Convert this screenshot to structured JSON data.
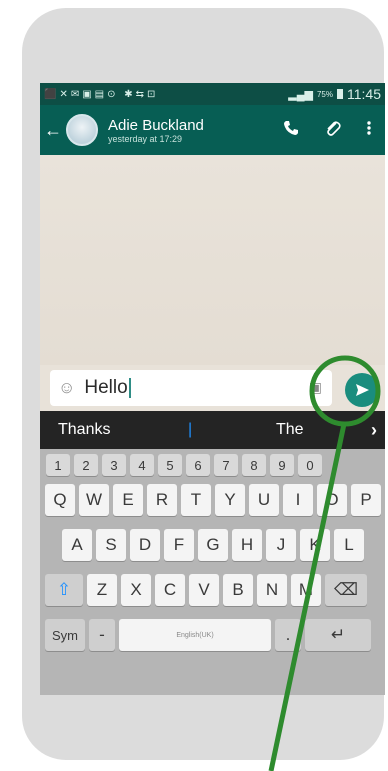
{
  "status": {
    "left_icons": "⬛✕✉▣▤⊙ ✱⇆⊡",
    "signal": "▂▄▆",
    "battery": "75%",
    "time": "11:45"
  },
  "header": {
    "back": "←",
    "name": "Adie Buckland",
    "last_seen": "yesterday at 17:29"
  },
  "composer": {
    "text": "Hello",
    "emoji": "☺",
    "camera": "▣"
  },
  "suggestions": {
    "left": "Thanks",
    "middle": "|",
    "right": "The",
    "arrow": "›"
  },
  "keyboard": {
    "numbers": [
      "1",
      "2",
      "3",
      "4",
      "5",
      "6",
      "7",
      "8",
      "9",
      "0"
    ],
    "row1": [
      "Q",
      "W",
      "E",
      "R",
      "T",
      "Y",
      "U",
      "I",
      "O",
      "P"
    ],
    "row2": [
      "A",
      "S",
      "D",
      "F",
      "G",
      "H",
      "J",
      "K",
      "L"
    ],
    "row3": [
      "Z",
      "X",
      "C",
      "V",
      "B",
      "N",
      "M"
    ],
    "sym": "Sym",
    "space_label": "English(UK)",
    "period": ".",
    "enter": "↵",
    "backspace": "⌫",
    "shift": "⇧",
    "mic": "-"
  },
  "colors": {
    "accent": "#075e54",
    "send": "#1a8d7e",
    "highlight": "#2e8b2e"
  }
}
